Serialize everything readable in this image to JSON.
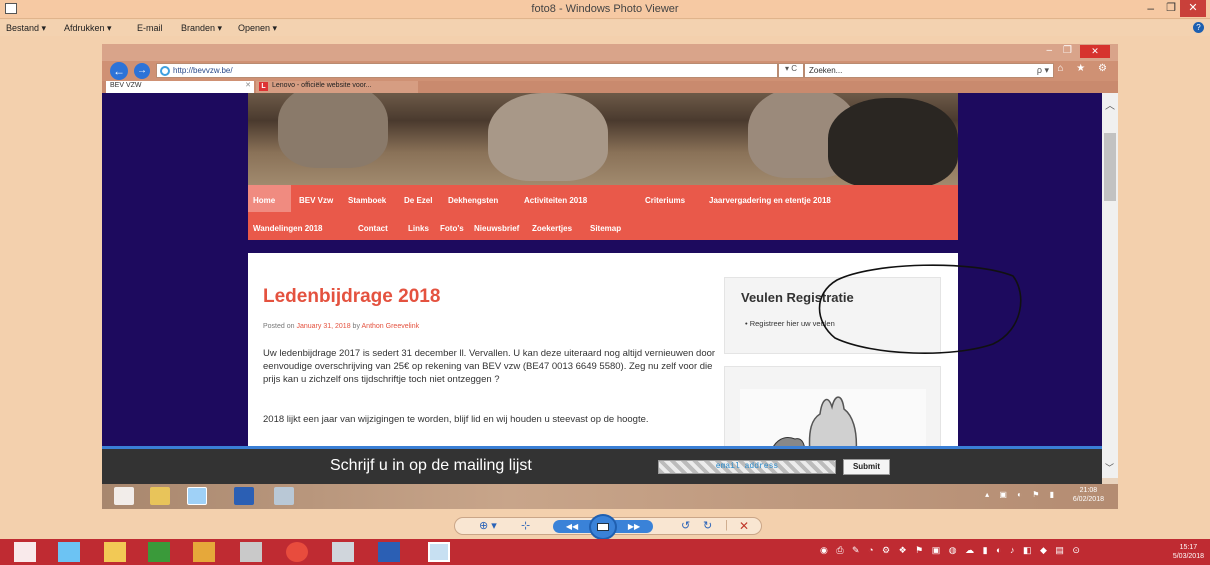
{
  "window": {
    "title": "foto8 - Windows Photo Viewer",
    "min": "–",
    "max": "❐",
    "close": "✕",
    "app_icon": "photo-viewer-icon"
  },
  "menu": {
    "items": [
      "Bestand ▾",
      "Afdrukken ▾",
      "E-mail",
      "Branden ▾",
      "Openen ▾"
    ],
    "help": "?"
  },
  "photo": {
    "ie": {
      "address": "http://bevvzw.be/",
      "refresh": "▾ C",
      "search_placeholder": "Zoeken...",
      "search_icon": "ρ ▾",
      "tools": "⌂ ★ ⚙",
      "back": "←",
      "forward": "→",
      "tabs": [
        {
          "label": "BEV VZW",
          "close": "✕"
        },
        {
          "label": "Lenovo - officiële website voor...",
          "icon_letter": "L"
        }
      ]
    },
    "site": {
      "nav": [
        "Home",
        "BEV Vzw",
        "Stamboek",
        "De Ezel",
        "Dekhengsten",
        "Activiteiten 2018",
        "Criteriums",
        "Jaarvergadering en etentje 2018",
        "Wandelingen 2018",
        "Contact",
        "Links",
        "Foto's",
        "Nieuwsbrief",
        "Zoekertjes",
        "Sitemap"
      ],
      "article": {
        "title": "Ledenbijdrage 2018",
        "meta_prefix": "Posted on",
        "date": "January 31, 2018",
        "meta_by": "by",
        "author": "Anthon Greevelink",
        "p1": "Uw ledenbijdrage 2017 is sedert 31 december ll. Vervallen. U kan deze uiteraard nog altijd vernieuwen door eenvoudige overschrijving van 25€ op rekening van BEV vzw (BE47 0013 6649 5580). Zeg nu zelf voor die prijs kan u zichzelf ons tijdschriftje toch niet ontzeggen ?",
        "p2": "2018 lijkt een jaar van wijzigingen te worden, blijf lid en wij houden u steevast op de hoogte."
      },
      "widget": {
        "title": "Veulen Registratie",
        "item": "Registreer hier uw veulen"
      },
      "mailing": {
        "text": "Schrijf u in op de mailing lijst",
        "email_placeholder": "email address",
        "submit": "Submit"
      },
      "inner_clock": {
        "time": "21:08",
        "date": "6/02/2018"
      }
    }
  },
  "viewer_toolbar": {
    "zoom": "⊕ ▾",
    "fit": "⊹",
    "prev": "◀◀",
    "next": "▶▶",
    "rotate_ccw": "↺",
    "rotate_cw": "↻",
    "delete": "✕"
  },
  "taskbar": {
    "time": "15:17",
    "date": "5/03/2018"
  },
  "colors": {
    "nav_red": "#e9594a",
    "title_red": "#e4523f",
    "site_bg": "#1d0a5e",
    "taskbar": "#bf2b32"
  }
}
